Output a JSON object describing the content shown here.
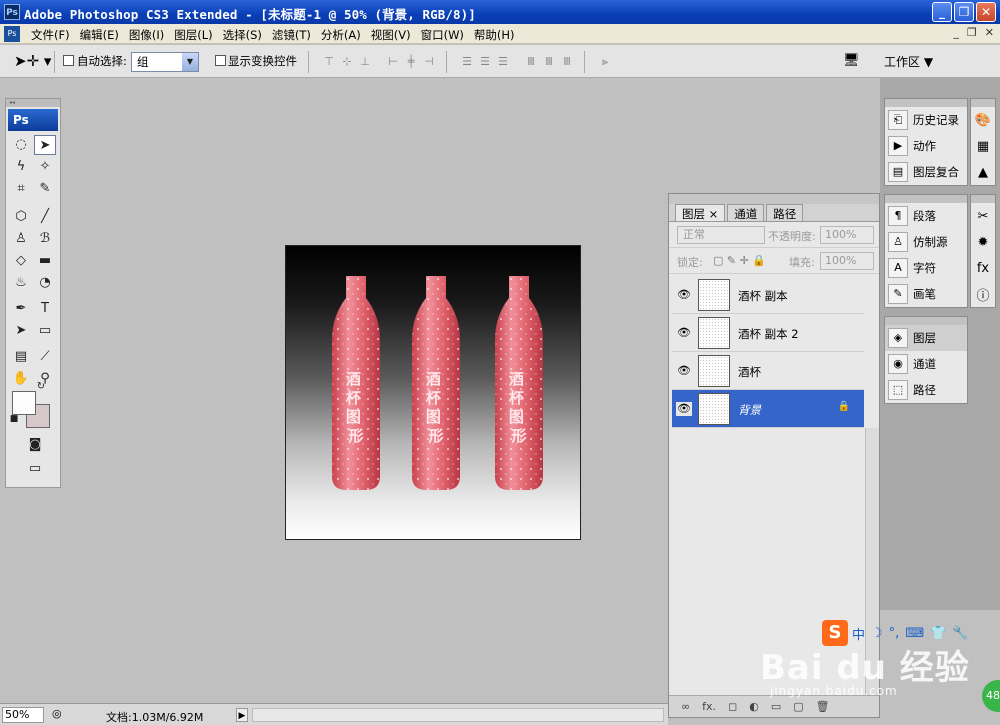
{
  "window": {
    "title": "Adobe Photoshop CS3 Extended - [未标题-1 @ 50% (背景, RGB/8)]",
    "logo": "Ps",
    "minimize": "_",
    "restore": "❐",
    "close": "✕"
  },
  "menu": {
    "items": [
      "文件(F)",
      "编辑(E)",
      "图像(I)",
      "图层(L)",
      "选择(S)",
      "滤镜(T)",
      "分析(A)",
      "视图(V)",
      "窗口(W)",
      "帮助(H)"
    ],
    "mdi": [
      "_",
      "❐",
      "✕"
    ]
  },
  "options": {
    "auto_select_label": "自动选择:",
    "auto_select_value": "组",
    "show_transform_label": "显示变换控件",
    "workspace_label": "工作区 ▼"
  },
  "toolbox": {
    "logo": "Ps"
  },
  "document": {
    "bottle_text": [
      "酒",
      "杯",
      "图",
      "形"
    ],
    "colors": {
      "bottle": "#e0606a",
      "bottle_light": "#f4a8b0"
    }
  },
  "layers_panel": {
    "tabs": [
      "图层 ×",
      "通道",
      "路径"
    ],
    "blend_mode": "正常",
    "opacity_label": "不透明度:",
    "opacity_value": "100%",
    "lock_label": "锁定:",
    "fill_label": "填充:",
    "fill_value": "100%",
    "layers": [
      {
        "name": "酒杯 副本",
        "selected": false
      },
      {
        "name": "酒杯 副本 2",
        "selected": false
      },
      {
        "name": "酒杯",
        "selected": false
      },
      {
        "name": "背景",
        "selected": true,
        "locked": true
      }
    ],
    "bottom_icons": [
      "∞",
      "fx.",
      "◻",
      "◐",
      "▭",
      "▢",
      "🗑"
    ]
  },
  "dock": {
    "group1": [
      "历史记录",
      "动作",
      "图层复合"
    ],
    "group2": [
      "段落",
      "仿制源",
      "字符",
      "画笔"
    ],
    "group3": [
      "图层",
      "通道",
      "路径"
    ]
  },
  "status": {
    "zoom": "50%",
    "doc_info": "文档:1.03M/6.92M"
  },
  "watermark": {
    "main": "Bai du 经验",
    "sub": "jingyan.baidu.com",
    "badge": "48"
  }
}
